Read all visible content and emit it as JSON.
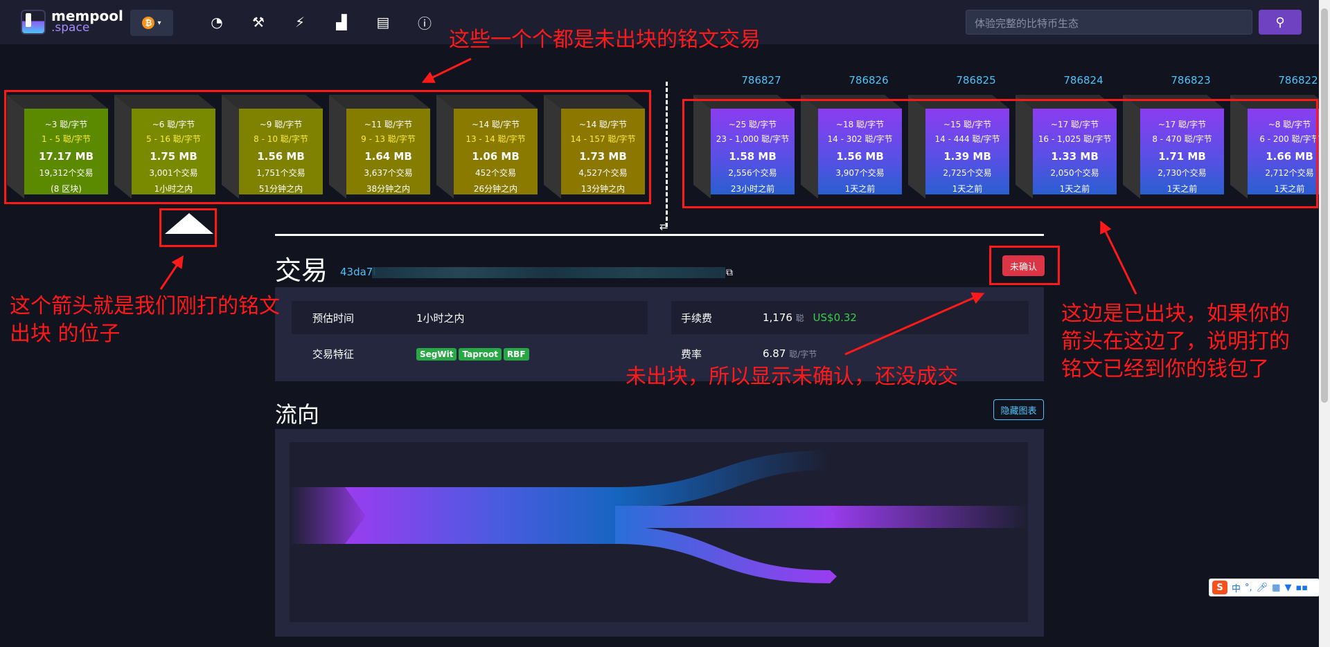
{
  "nav": {
    "logo_line1": "mempool",
    "logo_line2": ".space",
    "network_symbol": "₿",
    "icons": [
      "dashboard-icon",
      "mining-icon",
      "lightning-icon",
      "graphs-icon",
      "docs-icon",
      "about-icon"
    ],
    "search_placeholder": "体验完整的比特币生态"
  },
  "mempool_blocks": [
    {
      "fee": "~3 聪/字节",
      "range": "1 - 5 聪/字节",
      "size": "17.17 MB",
      "tx": "19,312个交易",
      "time": "(8 区块)",
      "color": "#5b8a00"
    },
    {
      "fee": "~6 聪/字节",
      "range": "5 - 16 聪/字节",
      "size": "1.75 MB",
      "tx": "3,001个交易",
      "time": "1小时之内",
      "color": "#7a8a00"
    },
    {
      "fee": "~9 聪/字节",
      "range": "8 - 10 聪/字节",
      "size": "1.56 MB",
      "tx": "1,751个交易",
      "time": "51分钟之内",
      "color": "#7f8200"
    },
    {
      "fee": "~11 聪/字节",
      "range": "9 - 13 聪/字节",
      "size": "1.64 MB",
      "tx": "3,637个交易",
      "time": "38分钟之内",
      "color": "#857d00"
    },
    {
      "fee": "~14 聪/字节",
      "range": "13 - 14 聪/字节",
      "size": "1.06 MB",
      "tx": "452个交易",
      "time": "26分钟之内",
      "color": "#8a7a00"
    },
    {
      "fee": "~14 聪/字节",
      "range": "14 - 157 聪/字节",
      "size": "1.73 MB",
      "tx": "4,527个交易",
      "time": "13分钟之内",
      "color": "#8c7800"
    }
  ],
  "mined_blocks": [
    {
      "height": "786827",
      "fee": "~25 聪/字节",
      "range": "23 - 1,000 聪/字节",
      "size": "1.58 MB",
      "tx": "2,556个交易",
      "time": "23小时之前"
    },
    {
      "height": "786826",
      "fee": "~18 聪/字节",
      "range": "14 - 302 聪/字节",
      "size": "1.56 MB",
      "tx": "3,907个交易",
      "time": "1天之前"
    },
    {
      "height": "786825",
      "fee": "~15 聪/字节",
      "range": "14 - 444 聪/字节",
      "size": "1.39 MB",
      "tx": "2,725个交易",
      "time": "1天之前"
    },
    {
      "height": "786824",
      "fee": "~17 聪/字节",
      "range": "16 - 1,025 聪/字节",
      "size": "1.33 MB",
      "tx": "2,050个交易",
      "time": "1天之前"
    },
    {
      "height": "786823",
      "fee": "~17 聪/字节",
      "range": "8 - 470 聪/字节",
      "size": "1.71 MB",
      "tx": "2,730个交易",
      "time": "1天之前"
    },
    {
      "height": "786822",
      "fee": "~8 聪/字节",
      "range": "6 - 200 聪/字节",
      "size": "1.66 MB",
      "tx": "2,712个交易",
      "time": "1天之前"
    }
  ],
  "tx": {
    "title": "交易",
    "hash_prefix": "43da7l",
    "status": "未确认",
    "eta_label": "预估时间",
    "eta_value": "1小时之内",
    "features_label": "交易特征",
    "features": [
      "SegWit",
      "Taproot",
      "RBF"
    ],
    "fee_label": "手续费",
    "fee_value": "1,176",
    "fee_unit": "聪",
    "fee_usd": "US$0.32",
    "rate_label": "费率",
    "rate_value": "6.87",
    "rate_unit": "聪/字节"
  },
  "flow": {
    "title": "流向",
    "hide_label": "隐藏图表"
  },
  "annotations": {
    "top": "这些一个个都是未出块的铭文交易",
    "left_l1": "这个箭头就是我们刚打的铭文",
    "left_l2": "出块 的位子",
    "right_l1": "这边是已出块，如果你的",
    "right_l2": "箭头在这边了，说明打的",
    "right_l3": "铭文已经到你的钱包了",
    "middle": "未出块，所以显示未确认，还没成交"
  },
  "ime": {
    "lang": "中"
  }
}
